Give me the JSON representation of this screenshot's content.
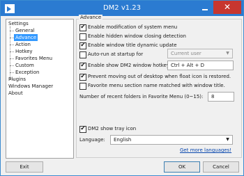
{
  "window": {
    "title": "DM2 v1.23",
    "close_glyph": "✕",
    "accent": "#2b7bd1",
    "close_color": "#c7362f"
  },
  "tree": {
    "items": [
      {
        "label": "Settings"
      },
      {
        "label": "General"
      },
      {
        "label": "Advance",
        "selected": true
      },
      {
        "label": "Action"
      },
      {
        "label": "Hotkey"
      },
      {
        "label": "Favorites Menu"
      },
      {
        "label": "Custom"
      },
      {
        "label": "Exception"
      },
      {
        "label": "Plugins"
      },
      {
        "label": "Windows Manager"
      },
      {
        "label": "About"
      }
    ]
  },
  "panel": {
    "group_title": "Advance",
    "options": [
      {
        "label": "Enable modification of system menu",
        "checked": true
      },
      {
        "label": "Enable hidden window closing detection",
        "checked": false
      },
      {
        "label": "Enable window title dynamic update",
        "checked": true
      },
      {
        "label": "Auto-run at startup for",
        "checked": false
      },
      {
        "label": "Enable show DM2 window hotkey",
        "checked": true
      },
      {
        "label": "Prevent moving out of desktop when float icon is restored.",
        "checked": true
      },
      {
        "label": "Favorite menu section name matched with window title.",
        "checked": false
      }
    ],
    "autorun_select": "Current user",
    "hotkey_value": "Ctrl + Alt + D",
    "recent_label": "Number of recent folders in Favorite Menu (0~15):",
    "recent_value": "8",
    "tray_label": "DM2 show tray icon",
    "tray_checked": true,
    "language_label": "Language:",
    "language_value": "English",
    "more_languages": "Get more languages!",
    "check_glyph": "✔",
    "dropdown_glyph": "▼"
  },
  "buttons": {
    "exit": "Exit",
    "ok": "OK",
    "cancel": "Cancel"
  }
}
